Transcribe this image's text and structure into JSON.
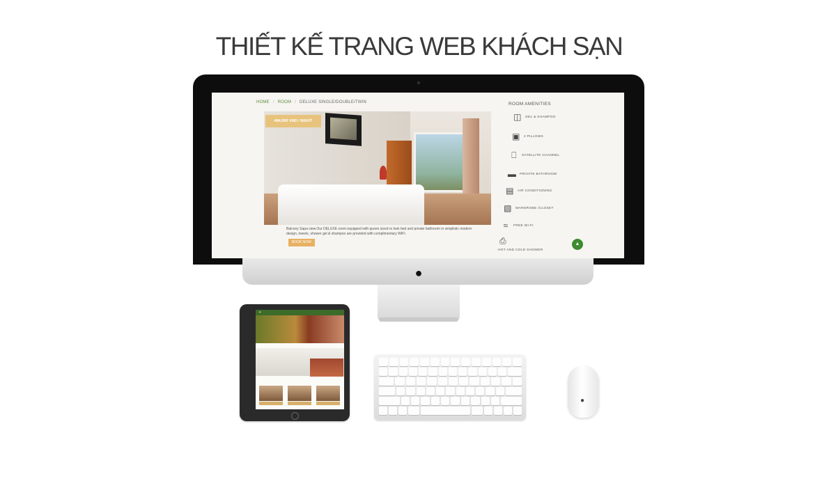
{
  "headline": "THIẾT KẾ TRANG WEB KHÁCH SẠN",
  "site": {
    "breadcrumb": {
      "home": "HOME",
      "sep1": "/",
      "room": "ROOM",
      "sep2": "/",
      "current": "DELUXE SINGLE/DOUBLE/TWIN"
    },
    "price": "484,000 VND / NIGHT",
    "description": "Balcony Sapa view.Our DELUXE room equipped with queen sized or twin bed and private bathroom in simplistic modern design, towels, shower gel & shampoo are provided with complimentary WIFI.",
    "book_button": "BOOK NOW",
    "amenities_title": "ROOM AMENITIES",
    "amenities": [
      {
        "label": "GEL & SHAMPOO",
        "icon": "shampoo-icon"
      },
      {
        "label": "2 PILLOWS",
        "icon": "pillow-icon"
      },
      {
        "label": "SATELLITE CHANNEL",
        "icon": "tv-icon"
      },
      {
        "label": "PRIVATE BATHROOM",
        "icon": "bathtub-icon"
      },
      {
        "label": "AIR CONDITIONING",
        "icon": "air-conditioner-icon"
      },
      {
        "label": "WARDROBE /CLOSET",
        "icon": "wardrobe-icon"
      },
      {
        "label": "FREE WI-FI",
        "icon": "wifi-icon"
      }
    ],
    "shower_label": "HOT AND COLD SHOWER",
    "accent_green": "#3d8b2f",
    "accent_gold": "#e8b061"
  }
}
